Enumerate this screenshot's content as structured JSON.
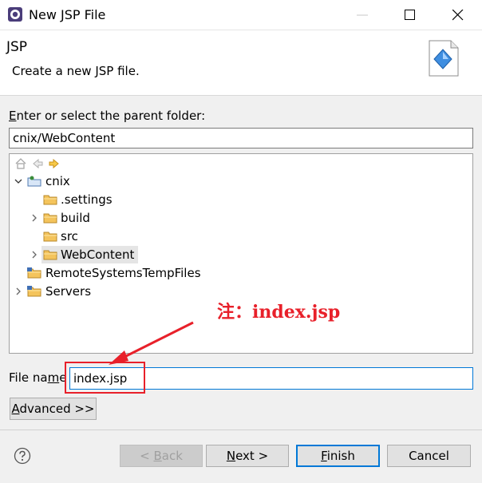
{
  "window": {
    "title": "New JSP File",
    "minimize_icon": "minimize-icon",
    "maximize_icon": "maximize-icon",
    "close_icon": "close-icon"
  },
  "header": {
    "title": "JSP",
    "description": "Create a new JSP file."
  },
  "folder": {
    "label_mnemonic": "E",
    "label_rest": "nter or select the parent folder:",
    "value": "cnix/WebContent"
  },
  "tree": {
    "toolbar": [
      "home-icon",
      "back-icon",
      "forward-icon"
    ],
    "items": [
      {
        "label": "cnix",
        "expanded": true,
        "level": 0,
        "icon": "project-icon"
      },
      {
        "label": ".settings",
        "level": 1,
        "icon": "folder-icon"
      },
      {
        "label": "build",
        "expanded": false,
        "level": 1,
        "icon": "folder-icon"
      },
      {
        "label": "src",
        "level": 1,
        "icon": "folder-icon"
      },
      {
        "label": "WebContent",
        "expanded": false,
        "level": 1,
        "icon": "folder-icon",
        "selected": true
      },
      {
        "label": "RemoteSystemsTempFiles",
        "level": 0,
        "icon": "project-folder-icon"
      },
      {
        "label": "Servers",
        "expanded": false,
        "level": 0,
        "icon": "project-folder-icon"
      }
    ]
  },
  "annotation": "注：index.jsp",
  "filename": {
    "label_before": "File na",
    "label_mnemonic": "m",
    "label_after": "e",
    "value": "index.jsp"
  },
  "buttons": {
    "advanced_mnemonic": "A",
    "advanced_rest": "dvanced >>",
    "back_prefix": "< ",
    "back_mnemonic": "B",
    "back_rest": "ack",
    "next_mnemonic": "N",
    "next_rest": "ext >",
    "finish_mnemonic": "F",
    "finish_rest": "inish",
    "cancel": "Cancel"
  },
  "colors": {
    "annotation": "#e8202a",
    "focus": "#0078d7",
    "folder": "#f4c45c"
  }
}
